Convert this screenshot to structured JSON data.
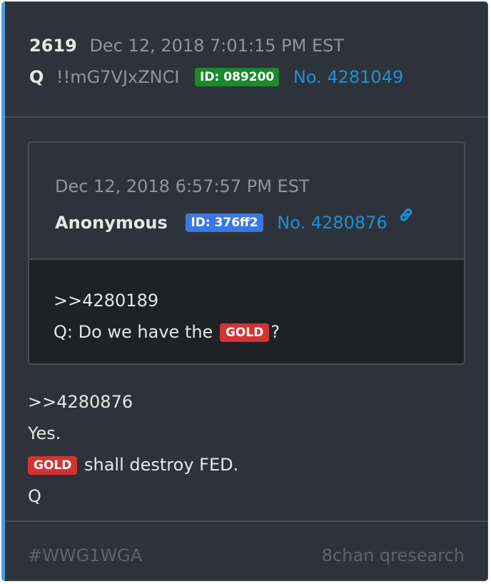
{
  "post": {
    "number": "2619",
    "timestamp": "Dec 12, 2018 7:01:15 PM EST",
    "author": "Q",
    "tripcode": "!!mG7VJxZNCI",
    "id_badge": "ID: 089200",
    "post_link": "No. 4281049",
    "id_badge_color": "#1a8a2a",
    "accent_color": "#4d9be6"
  },
  "quoted": {
    "timestamp": "Dec 12, 2018 6:57:57 PM EST",
    "author": "Anonymous",
    "id_badge": "ID: 376ff2",
    "id_badge_color": "#3a78e0",
    "post_link": "No. 4280876",
    "link_icon": "chain-link-icon",
    "reply_ref": ">>4280189",
    "text_before": "Q: Do we have the",
    "highlight": "GOLD",
    "text_after": "?"
  },
  "body": {
    "reply_ref": ">>4280876",
    "line2": "Yes.",
    "highlight": "GOLD",
    "line3_rest": "shall destroy FED.",
    "signature": "Q",
    "highlight_color": "#d33333"
  },
  "footer": {
    "hashtag": "#WWG1WGA",
    "source": "8chan qresearch"
  }
}
